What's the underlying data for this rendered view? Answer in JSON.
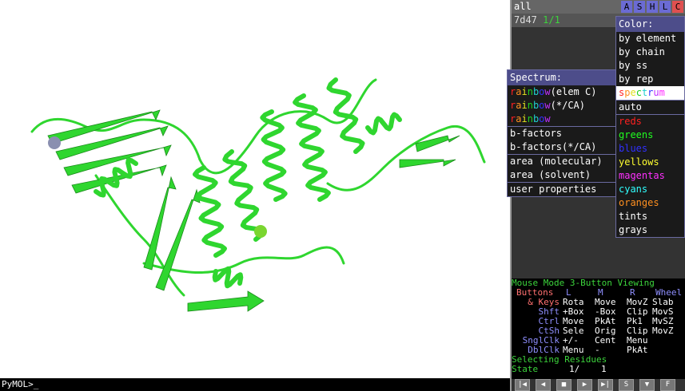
{
  "object_panel": {
    "all_label": "all",
    "obj_name": "7d47",
    "obj_state": "1/1",
    "buttons": [
      {
        "label": "A",
        "color": "#6b6bd4"
      },
      {
        "label": "S",
        "color": "#6b6bd4"
      },
      {
        "label": "H",
        "color": "#6b6bd4"
      },
      {
        "label": "L",
        "color": "#6b6bd4"
      },
      {
        "label": "C",
        "color": "#e05050"
      }
    ]
  },
  "color_menu": {
    "title": "Color:",
    "items": [
      {
        "label": "by element",
        "color": "#ffffff"
      },
      {
        "label": "by chain",
        "color": "#ffffff"
      },
      {
        "label": "by ss",
        "color": "#ffffff"
      },
      {
        "label": "by rep",
        "color": "#ffffff"
      },
      {
        "label": "spectrum",
        "color": "#ffffff",
        "highlight": true
      },
      {
        "label": "auto",
        "color": "#ffffff"
      },
      {
        "label": "reds",
        "color": "#ff2020"
      },
      {
        "label": "greens",
        "color": "#20ff20"
      },
      {
        "label": "blues",
        "color": "#3030ff"
      },
      {
        "label": "yellows",
        "color": "#ffff30"
      },
      {
        "label": "magentas",
        "color": "#ff30ff"
      },
      {
        "label": "cyans",
        "color": "#30ffff"
      },
      {
        "label": "oranges",
        "color": "#ff9020"
      },
      {
        "label": "tints",
        "color": "#ffffff"
      },
      {
        "label": "grays",
        "color": "#ffffff"
      }
    ]
  },
  "spectrum_menu": {
    "title": "Spectrum:",
    "items": [
      {
        "rainbow": "rainbow",
        "rest": "(elem C)"
      },
      {
        "rainbow": "rainbow",
        "rest": "(*/CA)"
      },
      {
        "rainbow": "rainbow",
        "rest": ""
      },
      {
        "label": "b-factors"
      },
      {
        "label": "b-factors(*/CA)"
      },
      {
        "label": "area (molecular)"
      },
      {
        "label": "area (solvent)"
      },
      {
        "label": "user properties"
      }
    ]
  },
  "mouse_panel": {
    "title1": "Mouse Mode ",
    "title2": "3-Button Viewing",
    "header": [
      "Buttons",
      "L",
      "M",
      "R",
      "Wheel"
    ],
    "rows": [
      {
        "mod": "& Keys",
        "cells": [
          "Rota",
          "Move",
          "MovZ",
          "Slab"
        ]
      },
      {
        "mod": "Shft",
        "cells": [
          "+Box",
          "-Box",
          "Clip",
          "MovS"
        ]
      },
      {
        "mod": "Ctrl",
        "cells": [
          "Move",
          "PkAt",
          "Pk1",
          "MvSZ"
        ]
      },
      {
        "mod": "CtSh",
        "cells": [
          "Sele",
          "Orig",
          "Clip",
          "MovZ"
        ]
      },
      {
        "mod": "SnglClk",
        "cells": [
          "+/-",
          "Cent",
          "Menu",
          ""
        ]
      },
      {
        "mod": "DblClk",
        "cells": [
          "Menu",
          "-",
          "PkAt",
          ""
        ]
      }
    ],
    "selecting_label": "Selecting Residues",
    "state_label": "State",
    "state_value": "1/",
    "state_total": "1"
  },
  "vcr_buttons": [
    "|◀",
    "◀",
    "■",
    "▶",
    "▶|",
    "S",
    "▼",
    "F"
  ],
  "command_line": {
    "prompt": "PyMOL>_"
  },
  "structure": {
    "ribbon_color": "#2fd62f",
    "ion_gray_color": "#8a8fb0",
    "ion_green_color": "#7ad630"
  }
}
